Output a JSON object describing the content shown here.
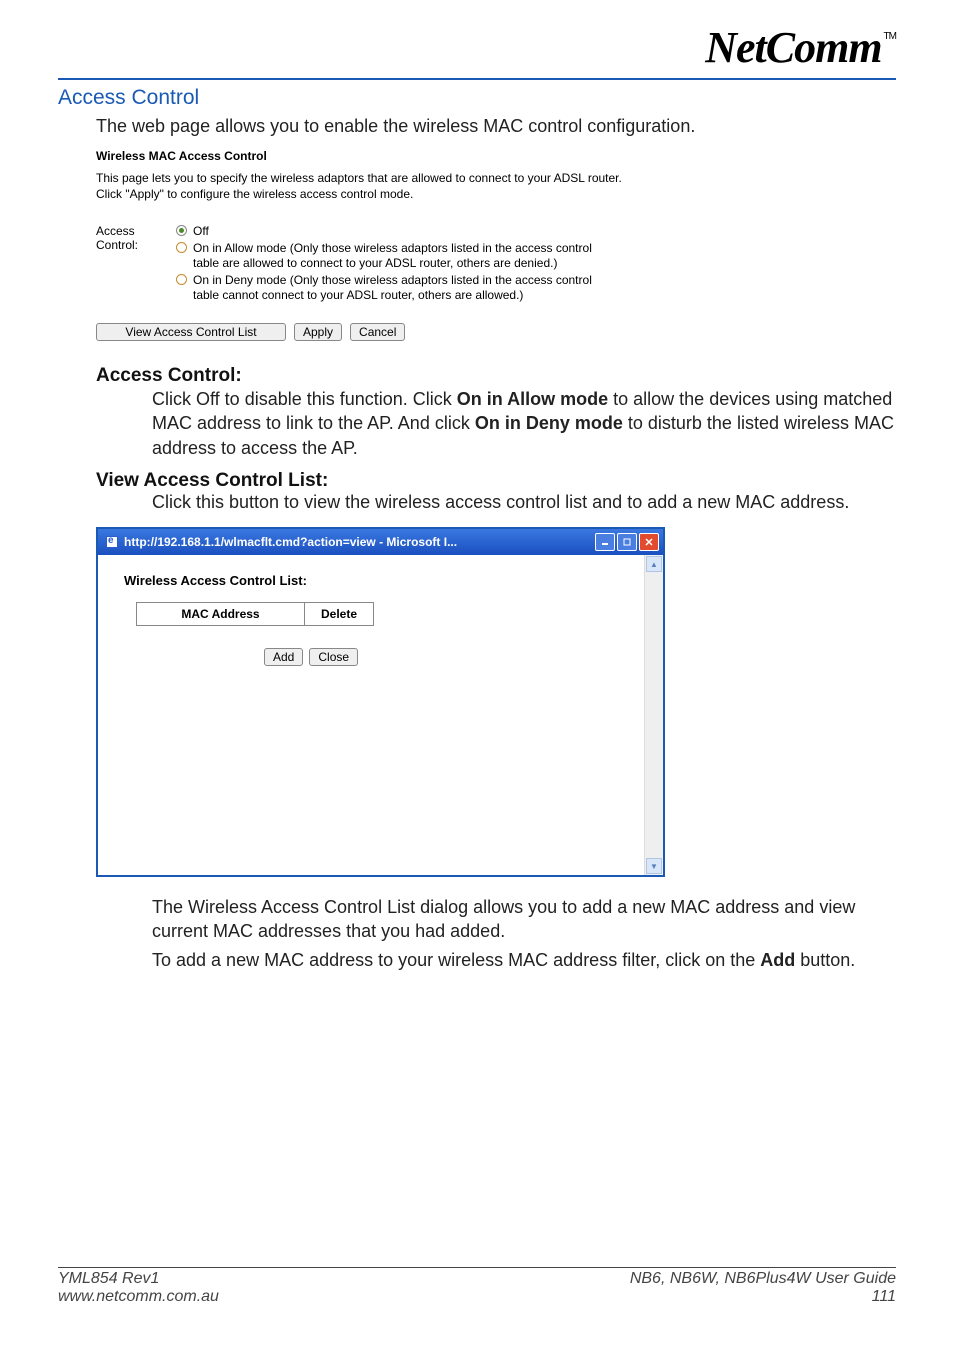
{
  "logo": {
    "brand": "NetComm",
    "tm": "TM"
  },
  "headings": {
    "access_control": "Access Control",
    "access_control_sub": "Access Control:",
    "view_list": "View Access Control List:"
  },
  "intro_line": "The web page allows you to enable the wireless MAC control configuration.",
  "fig1": {
    "title": "Wireless MAC Access Control",
    "desc_line1": "This page lets you to specify the wireless adaptors that are allowed to connect to your ADSL router.",
    "desc_line2": "Click \"Apply\" to configure the wireless access control mode.",
    "label": "Access Control:",
    "radios": {
      "off": "Off",
      "allow": "On in Allow mode (Only those wireless adaptors listed in the access control table are allowed to connect to your ADSL router, others are denied.)",
      "deny": "On in Deny mode (Only those wireless adaptors listed in the access control table cannot connect to your ADSL router, others are allowed.)"
    },
    "buttons": {
      "view": "View Access Control List",
      "apply": "Apply",
      "cancel": "Cancel"
    }
  },
  "explain1": {
    "pre": "Click Off to disable this function. Click ",
    "bold1": "On in Allow mode",
    "mid1": " to allow the devices using matched MAC address to link to the AP. And click ",
    "bold2": "On in Deny mode",
    "post": " to disturb the listed wireless MAC address to access the AP."
  },
  "explain2": "Click this button to view the wireless access control list and to add a new MAC address.",
  "popup": {
    "titlebar": "http://192.168.1.1/wlmacflt.cmd?action=view - Microsoft I...",
    "title": "Wireless Access Control List:",
    "col_mac": "MAC Address",
    "col_delete": "Delete",
    "buttons": {
      "add": "Add",
      "close": "Close"
    }
  },
  "after_popup": {
    "p1": "The Wireless Access Control List dialog allows you to add a new MAC address and view current MAC addresses that you had added.",
    "p2_pre": "To add a new MAC address to your wireless MAC address filter, click on the ",
    "p2_bold": "Add",
    "p2_post": " button."
  },
  "footer": {
    "left1": "YML854 Rev1",
    "left2": "www.netcomm.com.au",
    "right1_models": "NB6, NB6W, NB6Plus4W",
    "right1_suffix": " User Guide",
    "right2": "111"
  }
}
